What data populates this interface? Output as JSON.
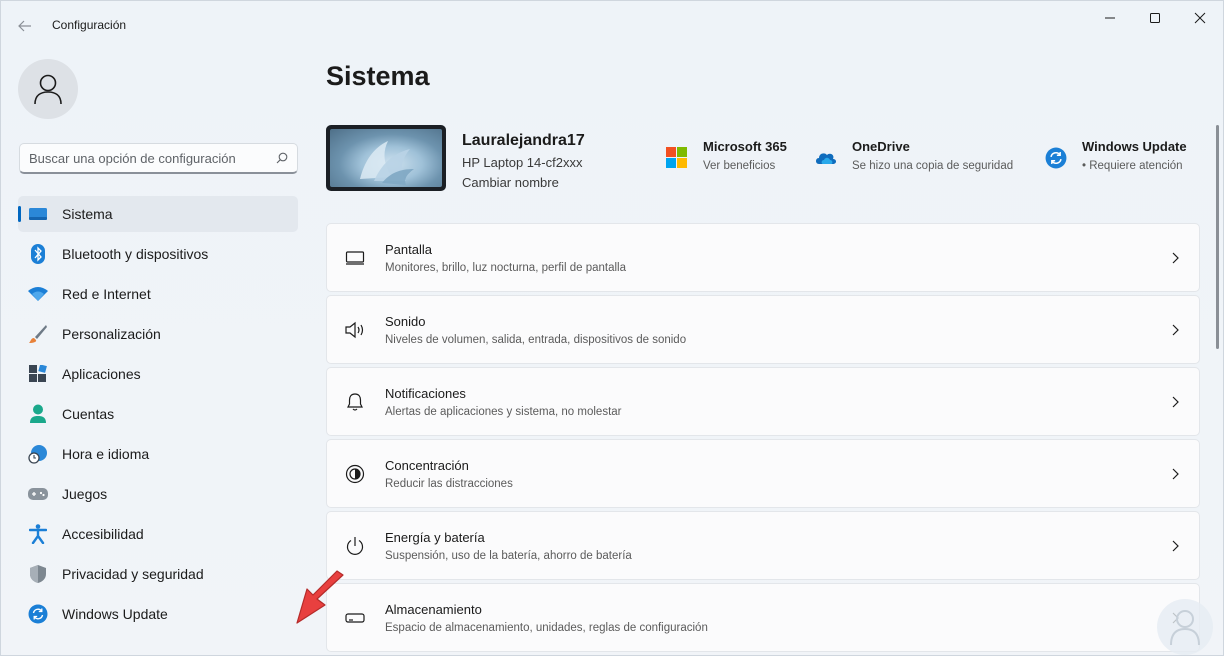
{
  "app": {
    "title": "Configuración"
  },
  "search": {
    "placeholder": "Buscar una opción de configuración"
  },
  "sidebar": {
    "items": [
      {
        "label": "Sistema",
        "icon": "system-icon",
        "active": true
      },
      {
        "label": "Bluetooth y dispositivos",
        "icon": "bluetooth-icon"
      },
      {
        "label": "Red e Internet",
        "icon": "wifi-icon"
      },
      {
        "label": "Personalización",
        "icon": "brush-icon"
      },
      {
        "label": "Aplicaciones",
        "icon": "apps-icon"
      },
      {
        "label": "Cuentas",
        "icon": "accounts-icon"
      },
      {
        "label": "Hora e idioma",
        "icon": "time-language-icon"
      },
      {
        "label": "Juegos",
        "icon": "gamepad-icon"
      },
      {
        "label": "Accesibilidad",
        "icon": "accessibility-icon"
      },
      {
        "label": "Privacidad y seguridad",
        "icon": "shield-icon"
      },
      {
        "label": "Windows Update",
        "icon": "windows-update-icon"
      }
    ]
  },
  "main": {
    "title": "Sistema",
    "device": {
      "name": "Lauralejandra17",
      "model": "HP Laptop 14-cf2xxx",
      "rename": "Cambiar nombre"
    },
    "quick_links": [
      {
        "title": "Microsoft 365",
        "subtitle": "Ver beneficios",
        "icon": "microsoft-365-icon"
      },
      {
        "title": "OneDrive",
        "subtitle": "Se hizo una copia de seguridad",
        "icon": "onedrive-icon"
      },
      {
        "title": "Windows Update",
        "subtitle": "• Requiere atención",
        "icon": "windows-update-icon"
      }
    ],
    "cards": [
      {
        "title": "Pantalla",
        "subtitle": "Monitores, brillo, luz nocturna, perfil de pantalla",
        "icon": "display-icon"
      },
      {
        "title": "Sonido",
        "subtitle": "Niveles de volumen, salida, entrada, dispositivos de sonido",
        "icon": "speaker-icon"
      },
      {
        "title": "Notificaciones",
        "subtitle": "Alertas de aplicaciones y sistema, no molestar",
        "icon": "bell-icon"
      },
      {
        "title": "Concentración",
        "subtitle": "Reducir las distracciones",
        "icon": "focus-icon"
      },
      {
        "title": "Energía y batería",
        "subtitle": "Suspensión, uso de la batería, ahorro de batería",
        "icon": "power-icon"
      },
      {
        "title": "Almacenamiento",
        "subtitle": "Espacio de almacenamiento, unidades, reglas de configuración",
        "icon": "storage-icon"
      }
    ]
  },
  "colors": {
    "accent": "#0067c0",
    "arrow": "#e8403f"
  }
}
